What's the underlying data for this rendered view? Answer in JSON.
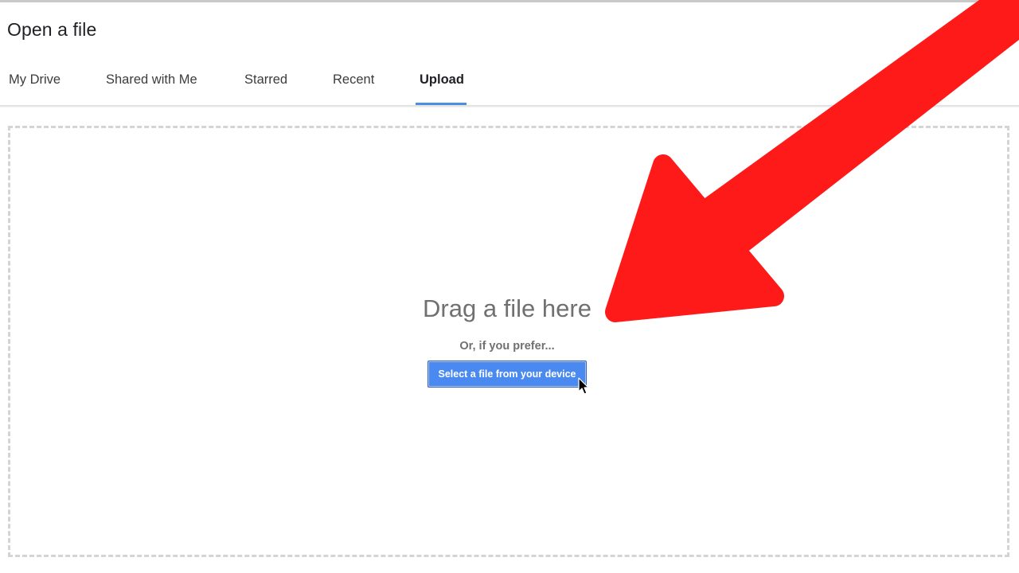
{
  "dialog": {
    "title": "Open a file"
  },
  "tabs": [
    {
      "label": "My Drive",
      "active": false
    },
    {
      "label": "Shared with Me",
      "active": false
    },
    {
      "label": "Starred",
      "active": false
    },
    {
      "label": "Recent",
      "active": false
    },
    {
      "label": "Upload",
      "active": true
    }
  ],
  "upload": {
    "heading": "Drag a file here",
    "alt_text": "Or, if you prefer...",
    "button_label": "Select a file from your device"
  },
  "colors": {
    "accent": "#4a90e2",
    "button": "#4a8af0",
    "annotation_arrow": "#ff1a1a"
  },
  "icons": {
    "cursor": "mouse-pointer-icon",
    "annotation": "red-arrow-annotation"
  }
}
